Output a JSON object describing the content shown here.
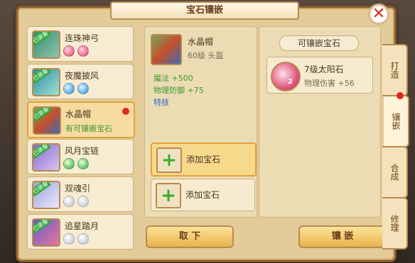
{
  "window": {
    "title": "宝石镶嵌",
    "close_icon": "close-icon"
  },
  "items": [
    {
      "label": "连珠神弓",
      "gems": [
        "red",
        "red"
      ],
      "badge": "已装备"
    },
    {
      "label": "夜魔披风",
      "gems": [
        "blue",
        "blue"
      ],
      "badge": "已装备"
    },
    {
      "label": "水晶帽",
      "status": "有可镶嵌宝石",
      "badge": "已装备",
      "selected": true
    },
    {
      "label": "风月宝链",
      "gems": [
        "green",
        "green"
      ],
      "badge": "已装备"
    },
    {
      "label": "双魂引",
      "gems": [
        "white",
        "white"
      ],
      "badge": "已装备"
    },
    {
      "label": "追星踏月",
      "gems": [
        "white",
        "white"
      ],
      "badge": "已装备"
    }
  ],
  "detail": {
    "name": "水晶帽",
    "level_type": "60级 头盔",
    "stats": [
      {
        "name": "魔法",
        "value": "+500",
        "color": "#3e9a2e"
      },
      {
        "name": "物理防御",
        "value": "+75",
        "color": "#3e9a2e"
      },
      {
        "name": "特技",
        "value": "",
        "color": "#2a66c9"
      }
    ],
    "slots": [
      {
        "label": "添加宝石"
      },
      {
        "label": "添加宝石"
      }
    ]
  },
  "gems_panel": {
    "title": "可镶嵌宝石",
    "gems": [
      {
        "name": "7级太阳石",
        "stat": "物理伤害",
        "value": "+56",
        "count": "2"
      }
    ]
  },
  "buttons": {
    "remove": "取 下",
    "inlay": "镶 嵌"
  },
  "tabs": [
    "打造",
    "镶嵌",
    "合成",
    "修理"
  ]
}
